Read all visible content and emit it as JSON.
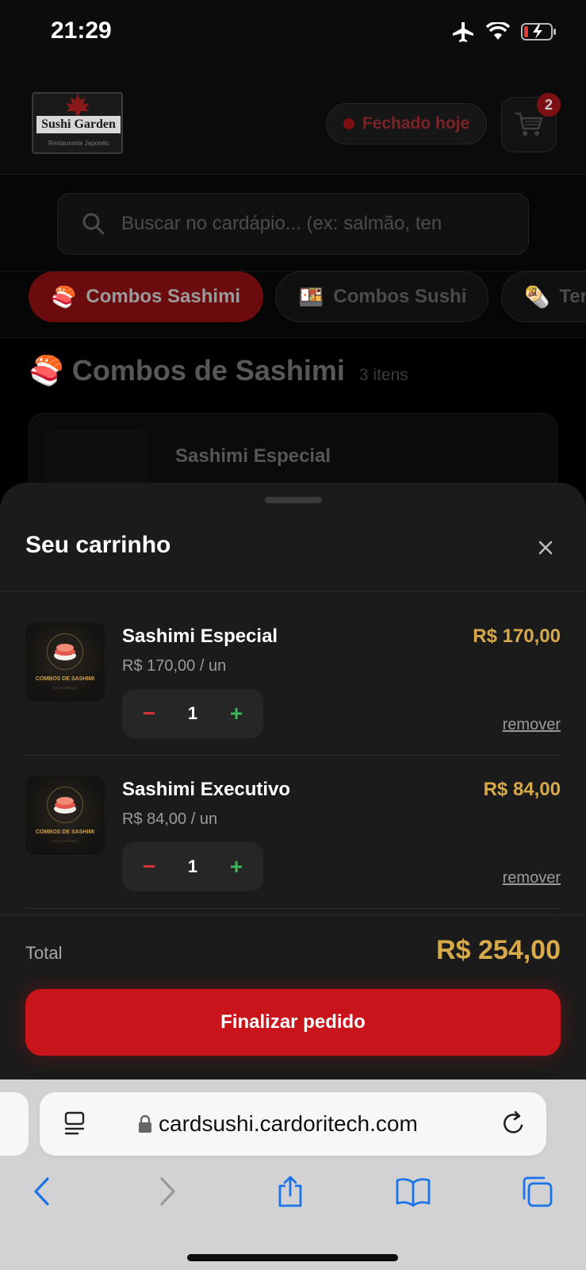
{
  "status_bar": {
    "time": "21:29"
  },
  "header": {
    "logo": {
      "title": "Sushi Garden",
      "subtitle": "Restaurante Japonês"
    },
    "status_pill": "Fechado hoje",
    "cart_count": "2"
  },
  "search": {
    "placeholder": "Buscar no cardápio... (ex: salmão, ten"
  },
  "categories": [
    {
      "emoji": "🍣",
      "label": "Combos Sashimi",
      "active": true
    },
    {
      "emoji": "🍱",
      "label": "Combos Sushi",
      "active": false
    },
    {
      "emoji": "🌯",
      "label": "Ter",
      "active": false
    }
  ],
  "section": {
    "emoji": "🍣",
    "title": "Combos de Sashimi",
    "count": "3 itens"
  },
  "preview_product": {
    "name": "Sashimi Especial"
  },
  "cart": {
    "title": "Seu carrinho",
    "items": [
      {
        "name": "Sashimi Especial",
        "unit_price": "R$ 170,00 / un",
        "total": "R$ 170,00",
        "qty": "1",
        "minus": "−",
        "plus": "+",
        "remove": "remover",
        "thumb_label": "COMBOS DE SASHIMI",
        "thumb_sub": "SUSHI GARDEN"
      },
      {
        "name": "Sashimi Executivo",
        "unit_price": "R$ 84,00 / un",
        "total": "R$ 84,00",
        "qty": "1",
        "minus": "−",
        "plus": "+",
        "remove": "remover",
        "thumb_label": "COMBOS DE SASHIMI",
        "thumb_sub": "SUSHI GARDEN"
      }
    ],
    "total_label": "Total",
    "total_value": "R$ 254,00",
    "checkout": "Finalizar pedido"
  },
  "browser": {
    "url": "cardsushi.cardoritech.com"
  },
  "colors": {
    "accent_red": "#c8141a",
    "price_gold": "#d8a94a",
    "plus_green": "#3ab55a",
    "minus_red": "#d23437"
  }
}
